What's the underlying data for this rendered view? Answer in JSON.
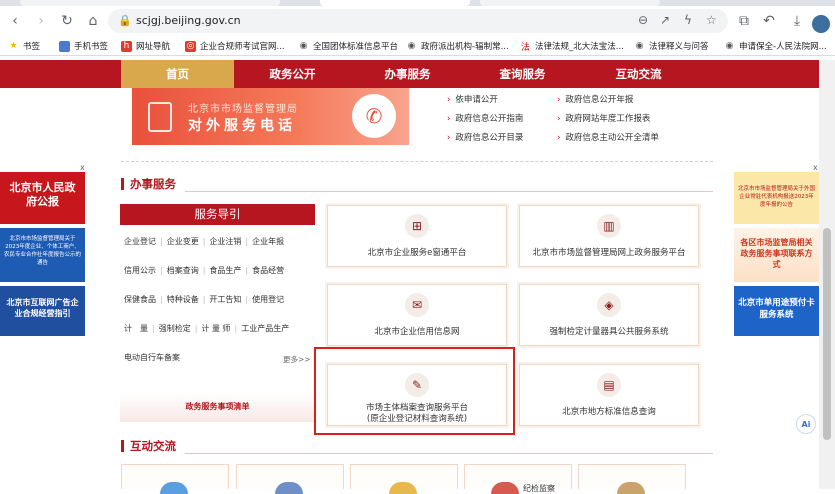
{
  "browser": {
    "url": "scjgj.beijing.gov.cn",
    "bookmarks": [
      "书签",
      "手机书签",
      "网址导航",
      "企业合规师考试官网...",
      "全国团体标准信息平台",
      "政府派出机构-辐制常...",
      "法律法规_北大法宝法...",
      "法律释义与问答",
      "申请保全-人民法院网..."
    ]
  },
  "nav": {
    "items": [
      "首页",
      "政务公开",
      "办事服务",
      "查询服务",
      "互动交流"
    ]
  },
  "hotline": {
    "line1": "北京市市场监督管理局",
    "line2": "对外服务电话"
  },
  "open_links": {
    "col1": [
      "依申请公开",
      "政府信息公开指南",
      "政府信息公开目录"
    ],
    "col2": [
      "政府信息公开年报",
      "政府网站年度工作报表",
      "政府信息主动公开全清单"
    ]
  },
  "services": {
    "title": "办事服务",
    "guide_title": "服务导引",
    "guide_rows": [
      [
        "企业登记",
        "企业变更",
        "企业注销",
        "企业年报"
      ],
      [
        "信用公示",
        "档案查询",
        "食品生产",
        "食品经营"
      ],
      [
        "保健食品",
        "特种设备",
        "开工告知",
        "使用登记"
      ],
      [
        "计　量",
        "强制检定",
        "计 量 师",
        "工业产品生产"
      ],
      [
        "电动自行车备案"
      ]
    ],
    "more": "更多>>",
    "list_banner": "政务服务事项清单",
    "cards": [
      {
        "label": "北京市企业服务e窗通平台",
        "icon": "network-icon"
      },
      {
        "label": "北京市市场监督管理局网上政务服务平台",
        "icon": "building-icon"
      },
      {
        "label": "北京市企业信用信息网",
        "icon": "envelope-icon"
      },
      {
        "label": "强制检定计量器具公共服务系统",
        "icon": "layers-icon"
      },
      {
        "label": "市场主体档案查询服务平台",
        "label2": "(原企业登记材料查询系统)",
        "icon": "edit-icon"
      },
      {
        "label": "北京市地方标准信息查询",
        "icon": "archive-icon"
      }
    ]
  },
  "interact": {
    "title": "互动交流",
    "partial_label": "纪检监察"
  },
  "ads": {
    "left": [
      {
        "text": "北京市人民政府公报"
      },
      {
        "text": "北京市市场监督管理局关于2023年度企业、个体工商户、农民专业合作社年度报告公示的通告"
      },
      {
        "text": "北京市互联网广告企业合规经营指引"
      }
    ],
    "right": [
      {
        "text": "北京市市场监督管理局关于外国企业常驻代表机构报送2023年度年报的公告"
      },
      {
        "text": "各区市场监管局相关政务服务事项联系方式"
      },
      {
        "text": "北京市单用途预付卡服务系统"
      }
    ],
    "close": "x"
  },
  "ai_label": "Ai"
}
